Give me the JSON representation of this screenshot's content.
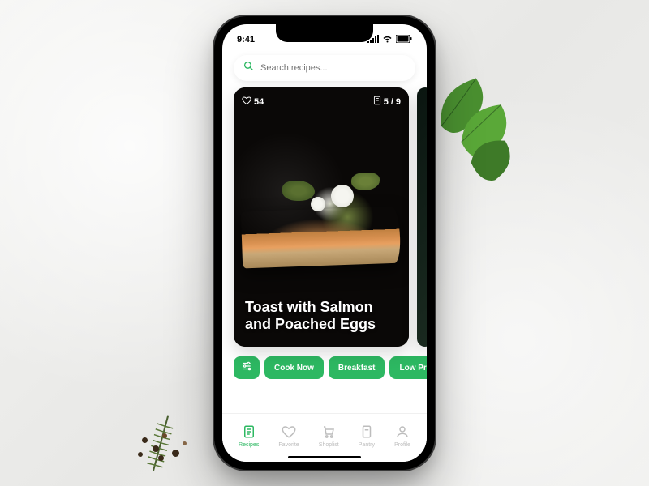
{
  "status": {
    "time": "9:41"
  },
  "search": {
    "placeholder": "Search recipes..."
  },
  "card": {
    "likes": "54",
    "ingredients_have": "5",
    "ingredients_total": "9",
    "title": "Toast with Salmon and Poached Eggs"
  },
  "filters": {
    "items": [
      "Cook Now",
      "Breakfast",
      "Low Price"
    ]
  },
  "tabs": {
    "items": [
      {
        "label": "Recipes",
        "active": true
      },
      {
        "label": "Favorite",
        "active": false
      },
      {
        "label": "Shoplist",
        "active": false
      },
      {
        "label": "Pantry",
        "active": false
      },
      {
        "label": "Profile",
        "active": false
      }
    ]
  },
  "colors": {
    "accent": "#2db862"
  }
}
